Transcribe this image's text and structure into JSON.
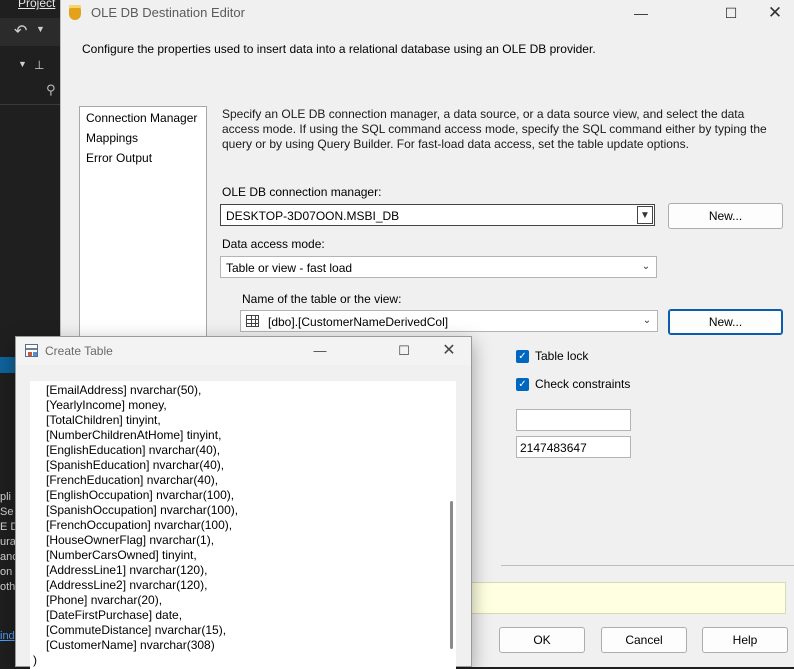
{
  "ide": {
    "menu_label": "Project",
    "side_text_lines": [
      "pli",
      "Se",
      "E D",
      "ura",
      "anc",
      "on",
      "oth"
    ],
    "bottom_link": "ind"
  },
  "dialog": {
    "title": "OLE DB Destination Editor",
    "description": "Configure the properties used to insert data into a relational database using an OLE DB provider.",
    "nav": [
      "Connection Manager",
      "Mappings",
      "Error Output"
    ],
    "main_description": "Specify an OLE DB connection manager, a data source, or a data source view, and select the data access mode. If using the SQL command access mode, specify the SQL command either by typing the query or by using Query Builder. For fast-load data access, set the table update options.",
    "connection_manager": {
      "label": "OLE DB connection manager:",
      "value": "DESKTOP-3D07OON.MSBI_DB",
      "new_button": "New..."
    },
    "access_mode": {
      "label": "Data access mode:",
      "value": "Table or view - fast load"
    },
    "table": {
      "label": "Name of the table or the view:",
      "value": "[dbo].[CustomerNameDerivedCol]",
      "new_button": "New..."
    },
    "options": {
      "table_lock": {
        "label": "Table lock",
        "checked": true
      },
      "check_constraints": {
        "label": "Check constraints",
        "checked": true
      },
      "rows_per_batch": "",
      "max_insert_commit": "2147483647"
    },
    "buttons": {
      "ok": "OK",
      "cancel": "Cancel",
      "help": "Help"
    }
  },
  "create_table": {
    "title": "Create Table",
    "lines": [
      "[EmailAddress] nvarchar(50),",
      "[YearlyIncome] money,",
      "[TotalChildren] tinyint,",
      "[NumberChildrenAtHome] tinyint,",
      "[EnglishEducation] nvarchar(40),",
      "[SpanishEducation] nvarchar(40),",
      "[FrenchEducation] nvarchar(40),",
      "[EnglishOccupation] nvarchar(100),",
      "[SpanishOccupation] nvarchar(100),",
      "[FrenchOccupation] nvarchar(100),",
      "[HouseOwnerFlag] nvarchar(1),",
      "[NumberCarsOwned] tinyint,",
      "[AddressLine1] nvarchar(120),",
      "[AddressLine2] nvarchar(120),",
      "[Phone] nvarchar(20),",
      "[DateFirstPurchase] date,",
      "[CommuteDistance] nvarchar(15),",
      "[CustomerName] nvarchar(308)"
    ],
    "closing": ")"
  }
}
